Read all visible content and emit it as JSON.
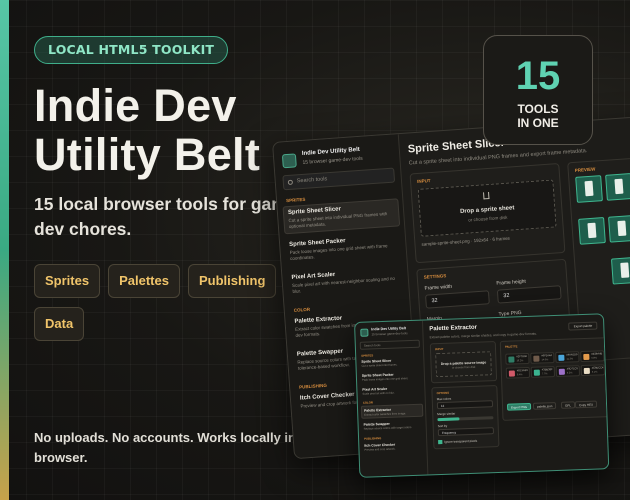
{
  "promo": {
    "pill": "LOCAL HTML5 TOOLKIT",
    "title_line1": "Indie Dev",
    "title_line2": "Utility Belt",
    "subtitle": "15 local browser tools for game-dev chores.",
    "tags": [
      "Sprites",
      "Palettes",
      "Publishing",
      "Data"
    ],
    "footer": "No uploads. No accounts. Works locally in your browser.",
    "badge": {
      "number": "15",
      "line1": "TOOLS",
      "line2": "IN ONE"
    }
  },
  "colors": {
    "accent_teal": "#5fd2b2",
    "accent_gold": "#f0c46a",
    "group_orange": "#d58c3e",
    "background": "#151412"
  },
  "main_window": {
    "app_name": "Indie Dev Utility Belt",
    "app_subtitle": "15 browser game-dev tools",
    "search_placeholder": "Search tools",
    "group_sprites": "SPRITES",
    "group_color": "COLOR",
    "group_publishing": "PUBLISHING",
    "items": [
      {
        "name": "Sprite Sheet Slicer",
        "desc": "Cut a sprite sheet into individual PNG frames with optional metadata."
      },
      {
        "name": "Sprite Sheet Packer",
        "desc": "Pack loose images into one grid sheet with frame coordinates."
      },
      {
        "name": "Pixel Art Scaler",
        "desc": "Scale pixel art with nearest-neighbor scaling and no blur."
      },
      {
        "name": "Palette Extractor",
        "desc": "Extract color swatches from image and copy them in dev formats."
      },
      {
        "name": "Palette Swapper",
        "desc": "Replace source colors with target colors in a tolerance-based workflow."
      },
      {
        "name": "Itch Cover Checker",
        "desc": "Preview and crop artwork for itch.io."
      }
    ],
    "heading": "Sprite Sheet Slicer",
    "heading_desc": "Cut a sprite sheet into individual PNG frames and export frame metadata.",
    "input_label": "INPUT",
    "drop_title": "Drop a sprite sheet",
    "drop_sub": "or choose from disk",
    "file_name": "sample-sprite-sheet.png · 192x64 · 6 frames",
    "settings_label": "SETTINGS",
    "frame_width_label": "Frame width",
    "frame_width": "32",
    "frame_height_label": "Frame height",
    "frame_height": "32",
    "margin_label": "Margin",
    "type_label": "Type PNG",
    "preview_label": "PREVIEW"
  },
  "second_window": {
    "app_name": "Indie Dev Utility Belt",
    "app_subtitle": "15 browser game-dev tools",
    "search_placeholder": "Search tools",
    "group_sprites": "SPRITES",
    "group_color": "COLOR",
    "group_publishing": "PUBLISHING",
    "items": [
      {
        "name": "Sprite Sheet Slicer",
        "desc": "Cut a sprite sheet into frames."
      },
      {
        "name": "Sprite Sheet Packer",
        "desc": "Pack loose images into one grid sheet."
      },
      {
        "name": "Pixel Art Scaler",
        "desc": "Scale pixel art with no blur."
      },
      {
        "name": "Palette Extractor",
        "desc": "Extract color swatches from image."
      },
      {
        "name": "Palette Swapper",
        "desc": "Replace source colors with target colors."
      },
      {
        "name": "Itch Cover Checker",
        "desc": "Preview and crop artwork."
      }
    ],
    "heading": "Palette Extractor",
    "heading_desc": "Extract palette colors, merge similar shades, and copy in game-dev formats.",
    "button": "Export palette",
    "input_label": "INPUT",
    "drop_title": "Drop a palette source image",
    "drop_sub": "or choose from disk",
    "options_label": "OPTIONS",
    "max_colors_label": "Max colors",
    "max_colors": "12",
    "merge_label": "Merge similar",
    "sort_label": "Sort by",
    "sort_value": "Frequency",
    "checkbox_label": "Ignore transparent pixels",
    "palette_label": "PALETTE",
    "swatches": [
      {
        "hex": "#2f7d66",
        "name": "#2F7D66",
        "ratio": "18.2%"
      },
      {
        "hex": "#6f5a4a",
        "name": "#6F5A4A",
        "ratio": "14.6%"
      },
      {
        "hex": "#4aa5d9",
        "name": "#4AA5D9",
        "ratio": "11.3%"
      },
      {
        "hex": "#e39a4b",
        "name": "#E39A4B",
        "ratio": "9.8%"
      },
      {
        "hex": "#d15a69",
        "name": "#D15A69",
        "ratio": "8.4%"
      },
      {
        "hex": "#3bb38f",
        "name": "#3BB38F",
        "ratio": "7.7%"
      },
      {
        "hex": "#9d71c9",
        "name": "#9D71C9",
        "ratio": "6.2%"
      },
      {
        "hex": "#e9dcc4",
        "name": "#E9DCC4",
        "ratio": "5.1%"
      }
    ],
    "actions": [
      "Export PNG",
      "palette.json",
      "GPL",
      "Copy HEX"
    ]
  }
}
